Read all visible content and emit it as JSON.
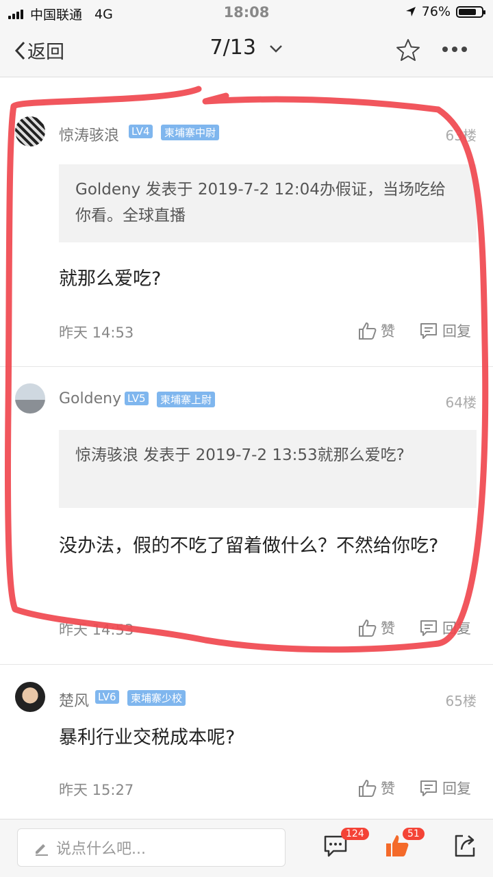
{
  "status_bar": {
    "carrier": "中国联通",
    "network": "4G",
    "time": "18:08",
    "battery": "76%"
  },
  "nav": {
    "back_label": "返回",
    "page_indicator": "7/13"
  },
  "posts": [
    {
      "user": "惊涛骇浪",
      "level": "LV4",
      "rank": "柬埔寨中尉",
      "floor": "63楼",
      "quote": "Goldeny 发表于 2019-7-2 12:04办假证，当场吃给你看。全球直播",
      "content": "就那么爱吃?",
      "time": "昨天 14:53",
      "like_label": "赞",
      "reply_label": "回复"
    },
    {
      "user": "Goldeny",
      "level": "LV5",
      "rank": "柬埔寨上尉",
      "floor": "64楼",
      "quote": "惊涛骇浪 发表于 2019-7-2 13:53就那么爱吃?",
      "content": "没办法，假的不吃了留着做什么？不然给你吃?",
      "time": "昨天 14:53",
      "like_label": "赞",
      "reply_label": "回复"
    },
    {
      "user": "楚风",
      "level": "LV6",
      "rank": "柬埔寨少校",
      "floor": "65楼",
      "content": "暴利行业交税成本呢?",
      "time": "昨天 15:27",
      "like_label": "赞",
      "reply_label": "回复"
    }
  ],
  "bottom_bar": {
    "input_placeholder": "说点什么吧...",
    "comment_count": "124",
    "like_count": "51"
  },
  "colors": {
    "accent": "#f46a2a",
    "annotation": "#f0484f",
    "level_badge": "#7fb6ee"
  }
}
